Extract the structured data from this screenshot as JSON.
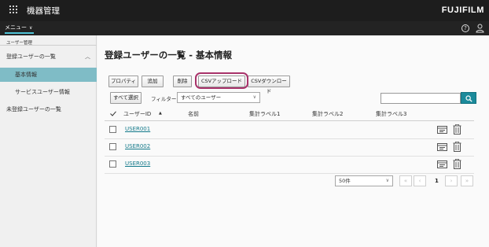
{
  "header": {
    "title": "機器管理",
    "brand": "FUJIFILM"
  },
  "menubar": {
    "menu_label": "メニュー"
  },
  "sidebar": {
    "section": "ユーザー管理",
    "items": [
      {
        "label": "登録ユーザーの一覧"
      },
      {
        "label": "基本情報"
      },
      {
        "label": "サービスユーザー情報"
      },
      {
        "label": "未登録ユーザーの一覧"
      }
    ]
  },
  "main": {
    "title": "登録ユーザーの一覧 - 基本情報",
    "toolbar": {
      "properties": "プロパティ",
      "add": "追加",
      "delete": "削除",
      "csv_upload": "CSVアップロード",
      "csv_download": "CSVダウンロード",
      "select_all": "すべて選択",
      "filter_label": "フィルター:",
      "filter_value": "すべてのユーザー",
      "search_placeholder": ""
    },
    "table": {
      "columns": [
        "ユーザーID",
        "名前",
        "集計ラベル1",
        "集計ラベル2",
        "集計ラベル3"
      ],
      "sort_indicator": "▲",
      "rows": [
        {
          "user_id": "USER001"
        },
        {
          "user_id": "USER002"
        },
        {
          "user_id": "USER003"
        }
      ]
    },
    "pagination": {
      "per_page": "50件",
      "page": "1"
    }
  },
  "colors": {
    "accent": "#1b8a9b",
    "sidebar_active": "#7fbcc6",
    "highlight": "#a8336a"
  }
}
